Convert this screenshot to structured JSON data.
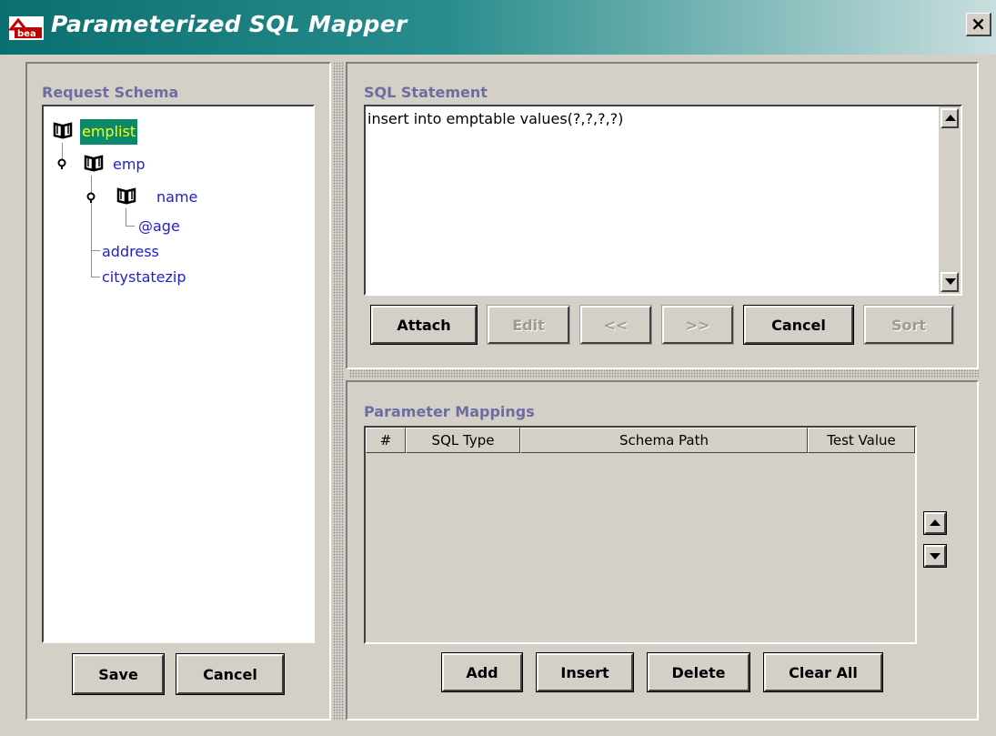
{
  "window": {
    "title": "Parameterized SQL Mapper",
    "close_label": "×"
  },
  "schema_panel": {
    "label": "Request Schema",
    "tree": {
      "root": "emplist",
      "child": "emp",
      "grandchild": "name",
      "attribute": "@age",
      "sibling1": "address",
      "sibling2": "citystatezip"
    },
    "save_label": "Save",
    "cancel_label": "Cancel"
  },
  "sql_panel": {
    "label": "SQL Statement",
    "statement": "insert into emptable values(?,?,?,?)",
    "buttons": {
      "attach": "Attach",
      "edit": "Edit",
      "prev": "<<",
      "next": ">>",
      "cancel": "Cancel",
      "sort": "Sort"
    }
  },
  "mappings_panel": {
    "label": "Parameter Mappings",
    "columns": [
      "#",
      "SQL Type",
      "Schema Path",
      "Test Value"
    ],
    "rows": [],
    "buttons": {
      "add": "Add",
      "insert": "Insert",
      "delete": "Delete",
      "clear_all": "Clear All"
    }
  },
  "colors": {
    "title_bar": "#0b6f6f",
    "selected_node": "#0a8a6a",
    "selected_text": "#ffff00",
    "tree_text": "#2020d0",
    "section_label": "#6d6da0"
  },
  "icons": {
    "app": "bea-app-icon",
    "node": "book-icon",
    "expander": "key-handle-icon",
    "scroll_up": "arrow-up-icon",
    "scroll_down": "arrow-down-icon"
  }
}
